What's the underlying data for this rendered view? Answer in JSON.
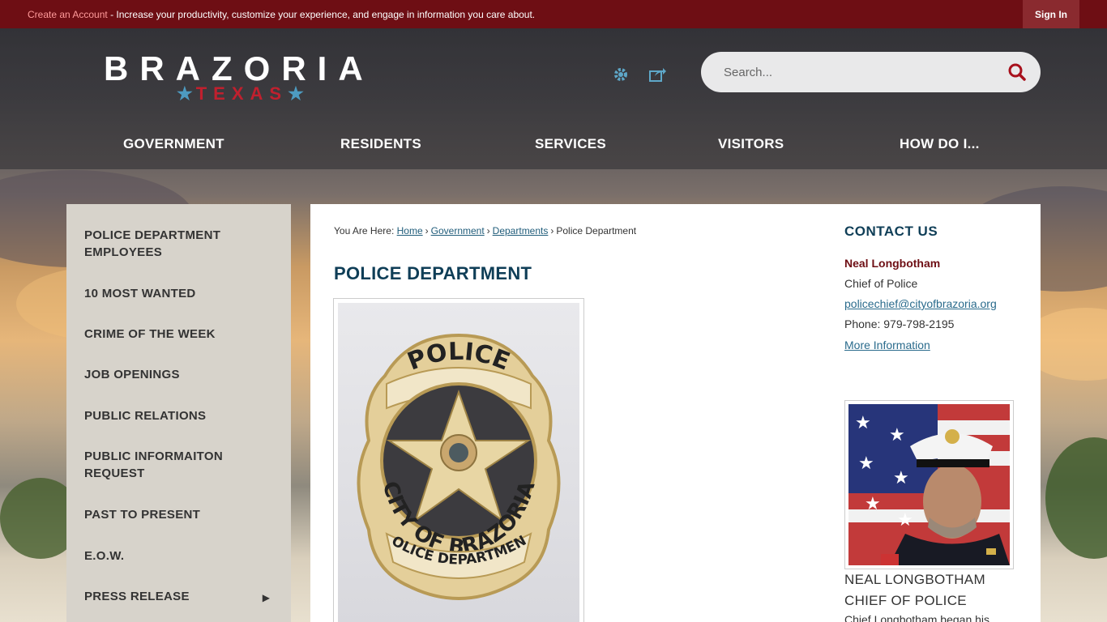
{
  "topbar": {
    "create_account": "Create an Account",
    "message": " - Increase your productivity, customize your experience, and engage in information you care about.",
    "sign_in": "Sign In"
  },
  "header": {
    "logo_main": "BRAZORIA",
    "logo_sub": "TEXAS",
    "search_placeholder": "Search..."
  },
  "nav": [
    {
      "label": "GOVERNMENT"
    },
    {
      "label": "RESIDENTS"
    },
    {
      "label": "SERVICES"
    },
    {
      "label": "VISITORS"
    },
    {
      "label": "HOW DO I..."
    }
  ],
  "sidebar": {
    "items": [
      {
        "label": "POLICE DEPARTMENT EMPLOYEES"
      },
      {
        "label": "10 MOST WANTED"
      },
      {
        "label": "CRIME OF THE WEEK"
      },
      {
        "label": "JOB OPENINGS"
      },
      {
        "label": "PUBLIC RELATIONS"
      },
      {
        "label": "PUBLIC INFORMAITON REQUEST"
      },
      {
        "label": "PAST TO PRESENT"
      },
      {
        "label": "E.O.W."
      },
      {
        "label": "PRESS RELEASE"
      }
    ]
  },
  "breadcrumb": {
    "prefix": "You Are Here:",
    "items": [
      "Home",
      "Government",
      "Departments"
    ],
    "current": "Police Department"
  },
  "page_title": "POLICE DEPARTMENT",
  "badge": {
    "top": "POLICE",
    "arc": "CITY OF BRAZORIA",
    "bottom": "POLICE DEPARTMENT"
  },
  "contact": {
    "title": "CONTACT US",
    "name": "Neal Longbotham",
    "role": "Chief of Police",
    "email": "policechief@cityofbrazoria.org",
    "phone": "Phone: 979-798-2195",
    "more": "More Information",
    "caption_name": "NEAL LONGBOTHAM",
    "caption_role": "CHIEF OF POLICE",
    "bio_start": "Chief Longbotham began his"
  },
  "colors": {
    "topbar": "#6e0e14",
    "accent_blue": "#0f3e57",
    "link": "#2a6b8c",
    "sidebar_bg": "#d7d3cb"
  }
}
